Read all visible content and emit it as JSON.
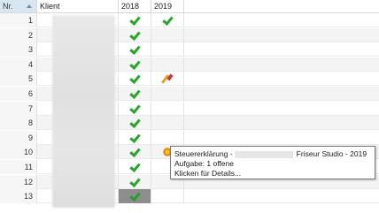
{
  "header": {
    "nr_label": "Nr.",
    "klient_label": "Klient",
    "year1": "2018",
    "year2": "2019"
  },
  "rows": [
    {
      "nr": "1",
      "y2018": "check",
      "y2019": "check"
    },
    {
      "nr": "2",
      "y2018": "check",
      "y2019": ""
    },
    {
      "nr": "3",
      "y2018": "check",
      "y2019": ""
    },
    {
      "nr": "4",
      "y2018": "check",
      "y2019": ""
    },
    {
      "nr": "5",
      "y2018": "check",
      "y2019": "pen"
    },
    {
      "nr": "6",
      "y2018": "check",
      "y2019": ""
    },
    {
      "nr": "7",
      "y2018": "check",
      "y2019": ""
    },
    {
      "nr": "8",
      "y2018": "check",
      "y2019": ""
    },
    {
      "nr": "9",
      "y2018": "check",
      "y2019": ""
    },
    {
      "nr": "10",
      "y2018": "check",
      "y2019": "gear"
    },
    {
      "nr": "11",
      "y2018": "check",
      "y2019": ""
    },
    {
      "nr": "12",
      "y2018": "check",
      "y2019": ""
    },
    {
      "nr": "13",
      "y2018": "check",
      "y2019": ""
    }
  ],
  "tooltip": {
    "line1_prefix": "Steuererklärung -",
    "line1_suffix": "Friseur Studio - 2019",
    "line2": "Aufgabe: 1 offene",
    "line3": "Klicken für Details..."
  },
  "colors": {
    "check": "#27a52c",
    "header_sorted_bg": "#d8e6f2",
    "selected_cell_bg": "#8d8d8d"
  },
  "icons": {
    "check": "check-icon",
    "pen": "pencil-icon",
    "gear": "gear-icon",
    "sort": "sort-ascending-icon"
  }
}
